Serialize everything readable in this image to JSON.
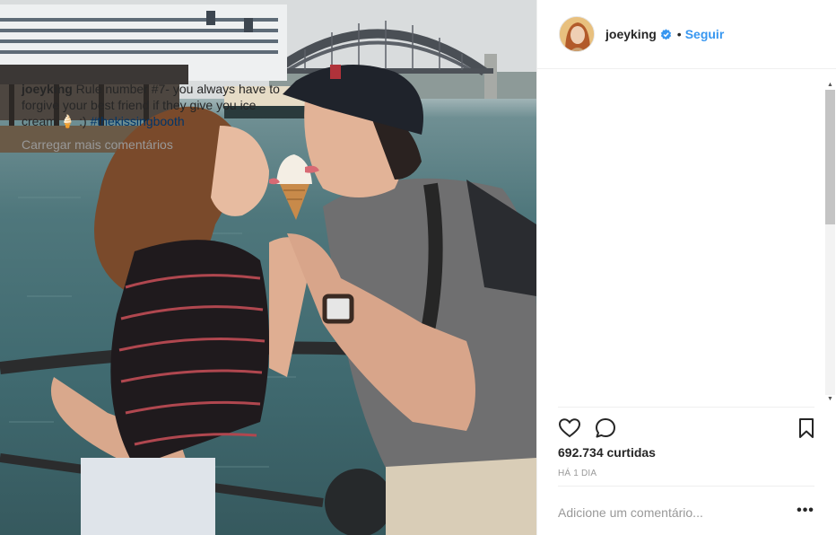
{
  "post": {
    "username": "joeyking",
    "verified": true,
    "separator": "•",
    "follow_label": "Seguir"
  },
  "caption": {
    "username": "joeyking",
    "text": " Rule number #7- you always have to forgive your best friend if they give you ice cream 🍦 :) ",
    "hashtag": "#thekissingbooth"
  },
  "comments": {
    "load_more_label": "Carregar mais comentários"
  },
  "actions": {
    "like_icon": "heart-icon",
    "comment_icon": "comment-icon",
    "save_icon": "bookmark-icon"
  },
  "stats": {
    "likes_count": "692.734",
    "likes_label": " curtidas",
    "time_ago": "HÁ 1 DIA"
  },
  "comment_box": {
    "placeholder": "Adicione um comentário...",
    "more_label": "•••"
  },
  "colors": {
    "link": "#3897f0",
    "hashtag": "#003569",
    "muted": "#999999",
    "text": "#262626"
  }
}
